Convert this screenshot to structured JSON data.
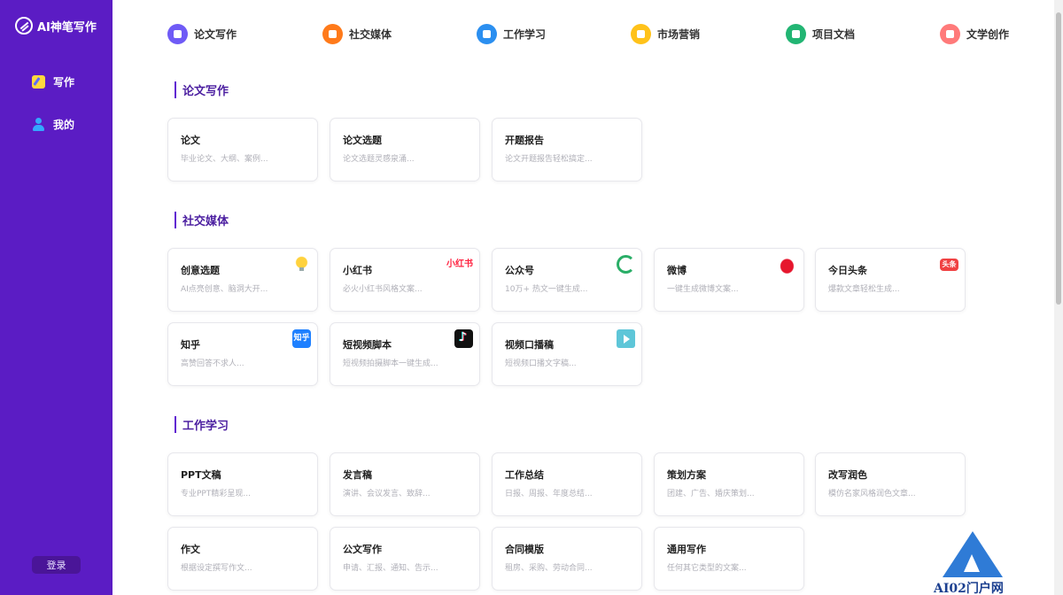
{
  "brand": {
    "name": "AI神笔写作"
  },
  "sidebar": {
    "items": [
      {
        "label": "写作"
      },
      {
        "label": "我的"
      }
    ],
    "login_label": "登录"
  },
  "topnav": [
    {
      "label": "论文写作",
      "color": "#6f5bf6"
    },
    {
      "label": "社交媒体",
      "color": "#ff7a1a"
    },
    {
      "label": "工作学习",
      "color": "#2b8ff0"
    },
    {
      "label": "市场营销",
      "color": "#ffc21a"
    },
    {
      "label": "项目文档",
      "color": "#22b573"
    },
    {
      "label": "文学创作",
      "color": "#ff7a7a"
    }
  ],
  "sections": [
    {
      "title": "论文写作",
      "cards": [
        {
          "title": "论文",
          "desc": "毕业论文、大纲、案例..."
        },
        {
          "title": "论文选题",
          "desc": "论文选题灵感泉涌..."
        },
        {
          "title": "开题报告",
          "desc": "论文开题报告轻松搞定..."
        }
      ]
    },
    {
      "title": "社交媒体",
      "cards": [
        {
          "title": "创意选题",
          "desc": "AI点亮创意、脑洞大开...",
          "icon": "lightbulb-icon"
        },
        {
          "title": "小红书",
          "desc": "必火小红书风格文案...",
          "icon": "xiaohongshu-logo-icon",
          "icon_text": "小红书"
        },
        {
          "title": "公众号",
          "desc": "10万+ 热文一键生成...",
          "icon": "wechat-official-icon"
        },
        {
          "title": "微博",
          "desc": "一键生成微博文案...",
          "icon": "weibo-icon"
        },
        {
          "title": "今日头条",
          "desc": "爆款文章轻松生成...",
          "icon": "toutiao-icon",
          "icon_text": "头条"
        },
        {
          "title": "知乎",
          "desc": "高赞回答不求人...",
          "icon": "zhihu-icon",
          "icon_text": "知乎"
        },
        {
          "title": "短视频脚本",
          "desc": "短视频拍摄脚本一键生成...",
          "icon": "douyin-icon"
        },
        {
          "title": "视频口播稿",
          "desc": "短视频口播文字稿...",
          "icon": "video-tv-icon"
        }
      ]
    },
    {
      "title": "工作学习",
      "cards": [
        {
          "title": "PPT文稿",
          "desc": "专业PPT精彩呈现..."
        },
        {
          "title": "发言稿",
          "desc": "演讲、会议发言、致辞..."
        },
        {
          "title": "工作总结",
          "desc": "日报、周报、年度总结..."
        },
        {
          "title": "策划方案",
          "desc": "团建、广告、婚庆策划..."
        },
        {
          "title": "改写润色",
          "desc": "模仿名家风格润色文章..."
        },
        {
          "title": "作文",
          "desc": "根据设定撰写作文..."
        },
        {
          "title": "公文写作",
          "desc": "申请、汇报、通知、告示..."
        },
        {
          "title": "合同模版",
          "desc": "租房、采购、劳动合同..."
        },
        {
          "title": "通用写作",
          "desc": "任何其它类型的文案..."
        }
      ]
    }
  ],
  "watermark": {
    "text": "AI02门户网"
  }
}
